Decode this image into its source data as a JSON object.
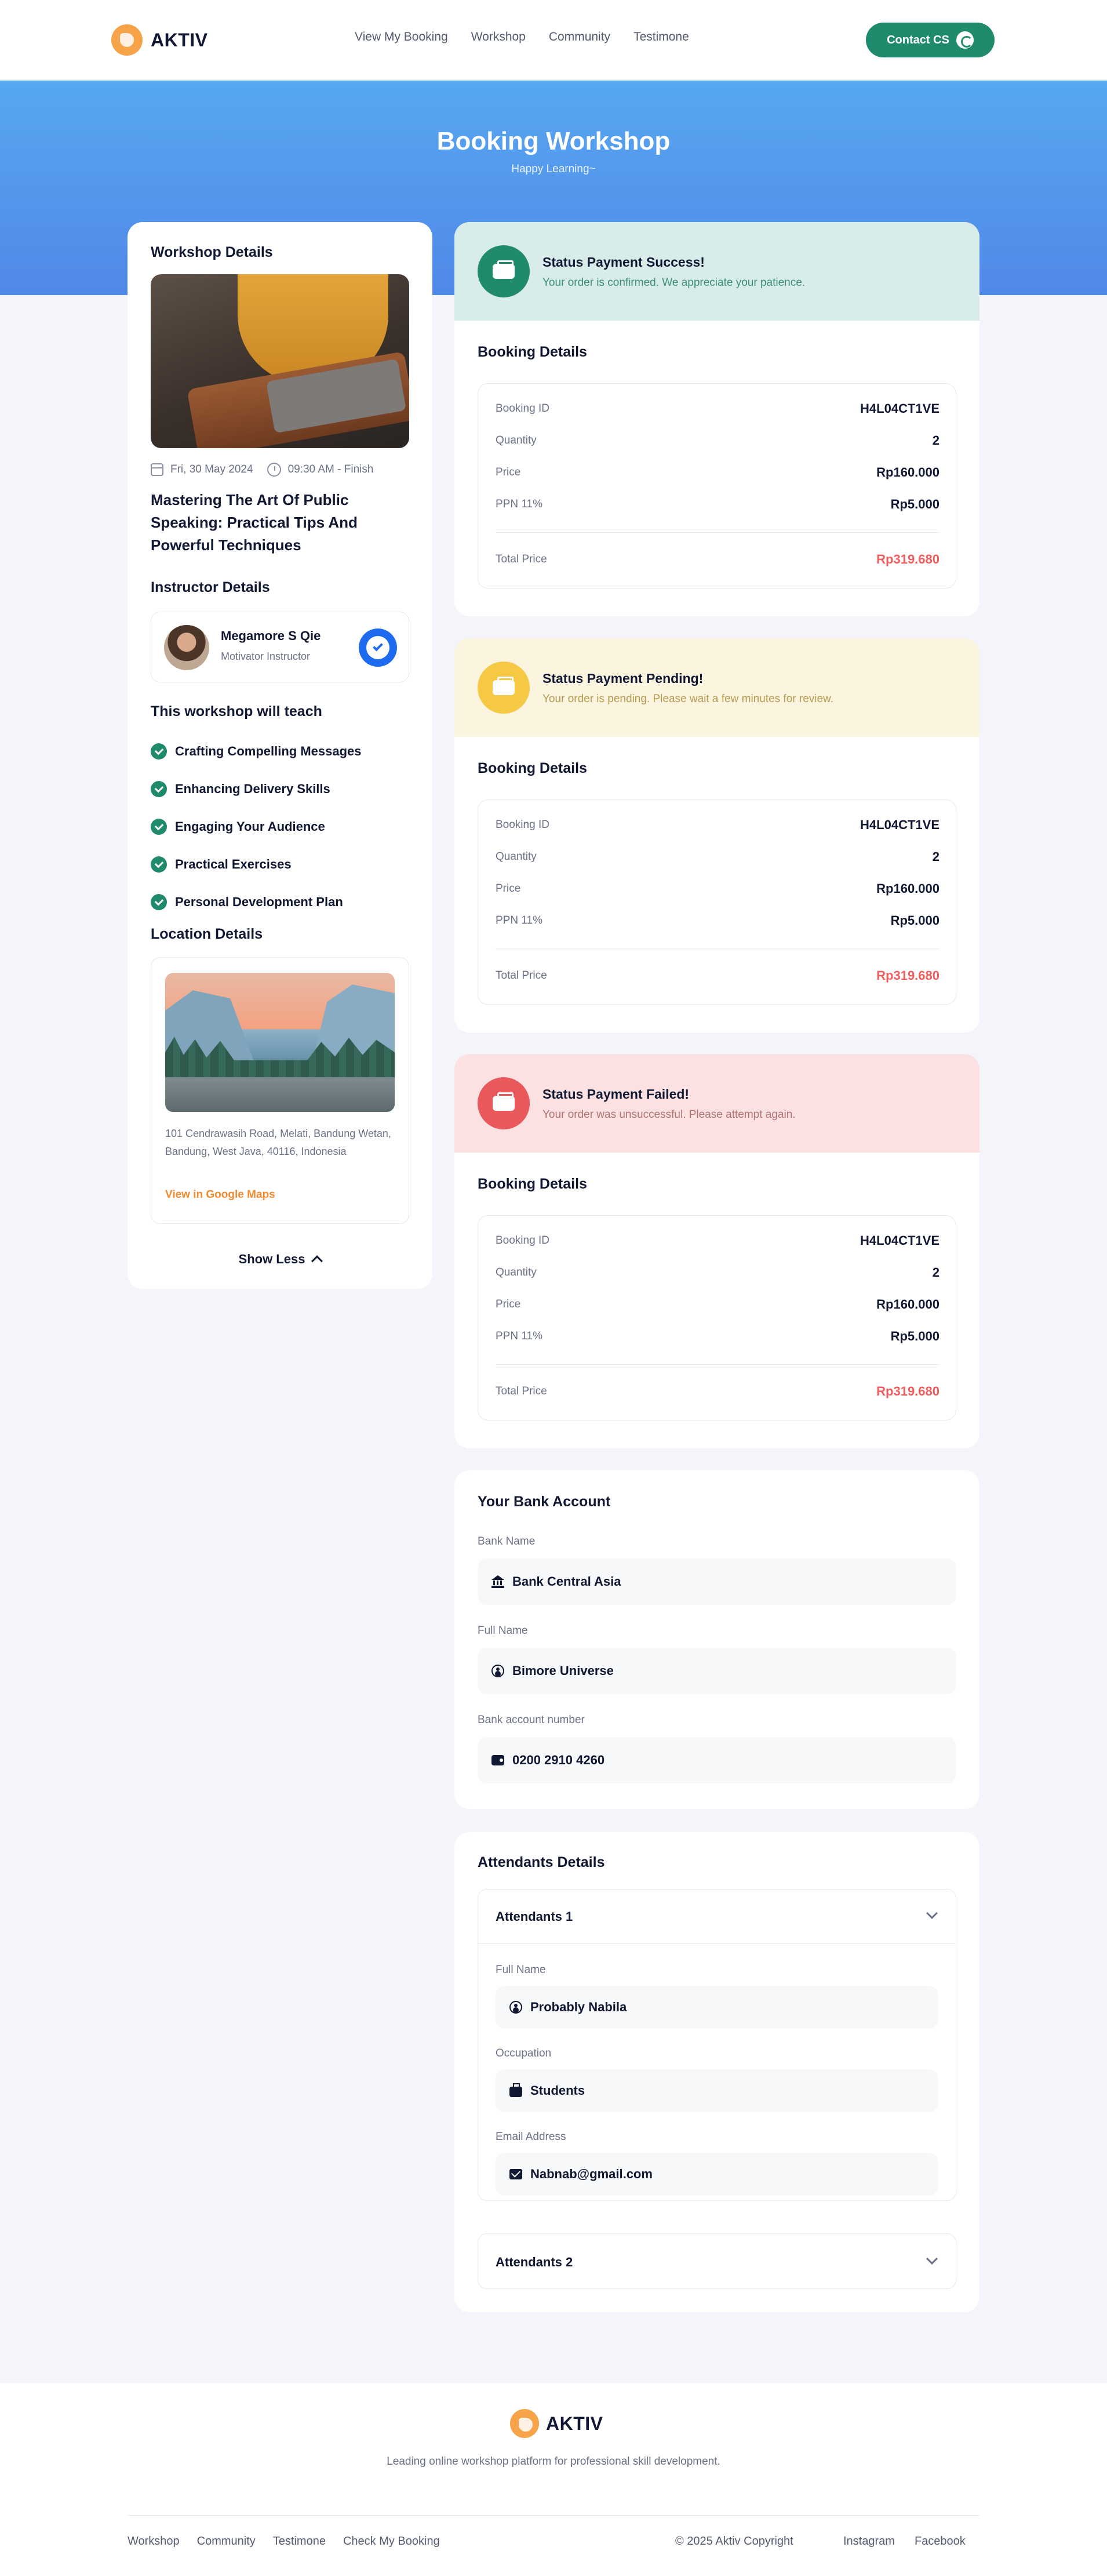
{
  "brand": {
    "name": "AKTIV"
  },
  "nav": {
    "items": [
      "View My Booking",
      "Workshop",
      "Community",
      "Testimone"
    ],
    "contact_label": "Contact CS"
  },
  "hero": {
    "title": "Booking Workshop",
    "subtitle": "Happy Learning~"
  },
  "workshop": {
    "section_title": "Workshop Details",
    "date": "Fri, 30 May 2024",
    "time": "09:30 AM - Finish",
    "title": "Mastering The Art Of Public Speaking: Practical Tips And Powerful Techniques",
    "instructor_title": "Instructor Details",
    "instructor": {
      "name": "Megamore S Qie",
      "role": "Motivator Instructor"
    },
    "teach_title": "This workshop will teach",
    "teach_items": [
      "Crafting Compelling Messages",
      "Enhancing Delivery Skills",
      "Engaging Your Audience",
      "Practical Exercises",
      "Personal Development Plan"
    ],
    "location_title": "Location Details",
    "address": "101 Cendrawasih Road, Melati, Bandung Wetan, Bandung, West Java, 40116, Indonesia",
    "maps_link": "View in Google Maps",
    "show_less": "Show Less"
  },
  "statuses": [
    {
      "title": "Status Payment Success!",
      "message": "Your order is confirmed. We appreciate your patience.",
      "bg": "#D8EDEA",
      "icon_color": "#1F8B6C",
      "msg_color": "#3C8F77"
    },
    {
      "title": "Status Payment Pending!",
      "message": "Your order is pending. Please wait a few minutes for review.",
      "bg": "#FBF4DF",
      "icon_color": "#F6C944",
      "msg_color": "#B79A4F"
    },
    {
      "title": "Status Payment Failed!",
      "message": "Your order was unsuccessful. Please attempt again.",
      "bg": "#FBE1E1",
      "icon_color": "#E9585A",
      "msg_color": "#B27373"
    }
  ],
  "booking": {
    "title": "Booking Details",
    "labels": {
      "id": "Booking ID",
      "qty": "Quantity",
      "price": "Price",
      "ppn": "PPN 11%",
      "total": "Total Price"
    },
    "values": {
      "id": "H4L04CT1VE",
      "qty": "2",
      "price": "Rp160.000",
      "ppn": "Rp5.000",
      "total": "Rp319.680"
    }
  },
  "bank": {
    "title": "Your Bank Account",
    "bank_name_label": "Bank Name",
    "bank_name": "Bank Central Asia",
    "full_name_label": "Full Name",
    "full_name": "Bimore Universe",
    "account_label": "Bank account number",
    "account": "0200 2910 4260"
  },
  "attendants": {
    "title": "Attendants Details",
    "items": [
      {
        "label": "Attendants 1",
        "full_name_label": "Full Name",
        "full_name": "Probably Nabila",
        "occupation_label": "Occupation",
        "occupation": "Students",
        "email_label": "Email Address",
        "email": "Nabnab@gmail.com"
      },
      {
        "label": "Attendants 2"
      }
    ]
  },
  "footer": {
    "description": "Leading online workshop platform for professional skill development.",
    "links": [
      "Workshop",
      "Community",
      "Testimone",
      "Check My Booking"
    ],
    "copyright": "© 2025 Aktiv Copyright",
    "social": [
      "Instagram",
      "Facebook"
    ]
  }
}
